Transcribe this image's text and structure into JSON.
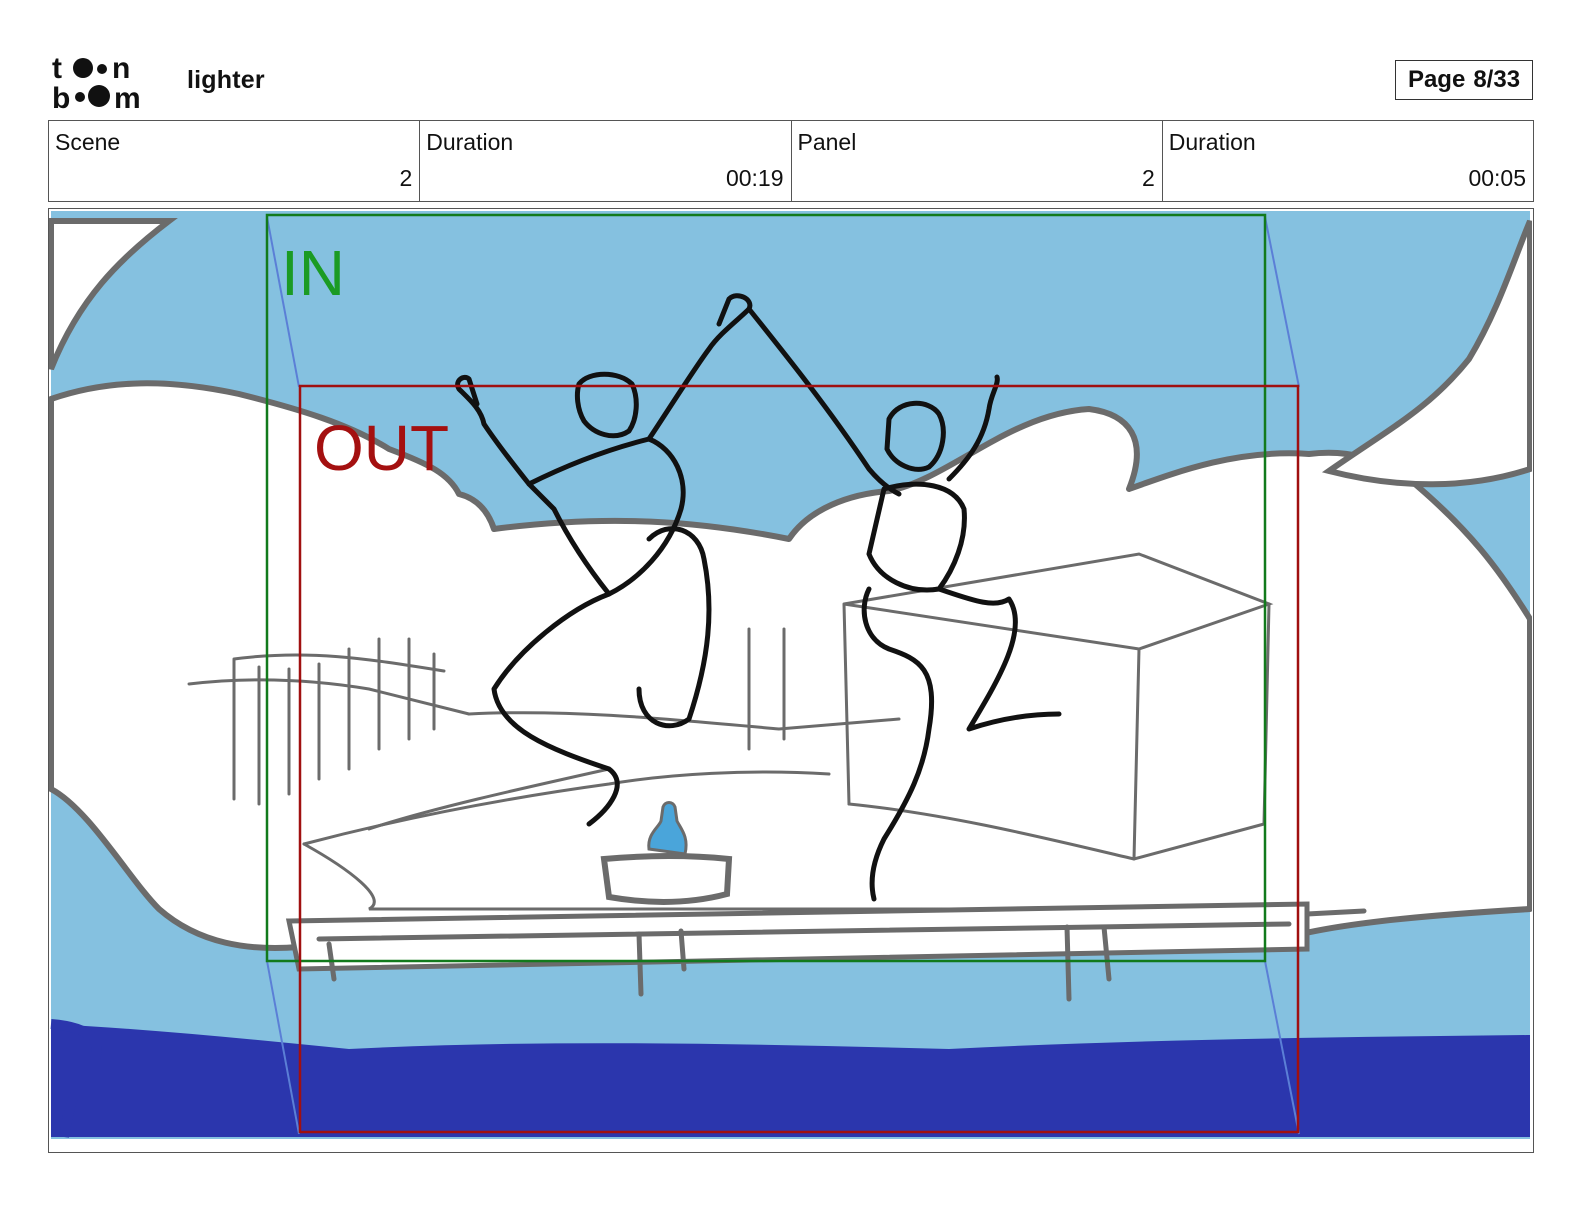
{
  "header": {
    "logo_text_top": "toon",
    "logo_text_bottom": "boom",
    "project_name": "lighter",
    "page_label": "Page",
    "page_value": "8/33"
  },
  "info": {
    "scene_label": "Scene",
    "scene_value": "2",
    "scene_duration_label": "Duration",
    "scene_duration_value": "00:19",
    "panel_label": "Panel",
    "panel_value": "2",
    "panel_duration_label": "Duration",
    "panel_duration_value": "00:05"
  },
  "panel": {
    "in_label": "IN",
    "out_label": "OUT",
    "colors": {
      "sky": "#85c1e0",
      "sea": "#2b36ad",
      "in_frame": "#127a1c",
      "in_text": "#1b9b24",
      "out_frame": "#a01010",
      "out_text": "#a41010",
      "bottle": "#4aa5da"
    }
  }
}
